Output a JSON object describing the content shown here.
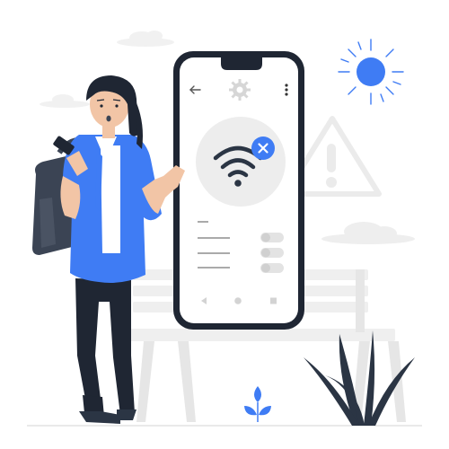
{
  "illustration": {
    "icons": {
      "back": "arrow-left-icon",
      "settings": "gear-icon",
      "menu": "more-vertical-icon",
      "wifi": "wifi-off-icon",
      "warning": "warning-triangle-icon",
      "sun": "sun-icon"
    },
    "colors": {
      "accent": "#3f7cf4",
      "dark": "#2b3544",
      "phone_frame": "#1f2633",
      "light_gray": "#ececec",
      "mid_gray": "#d9d9d9",
      "skin": "#f2c5a6"
    },
    "phone_toggles": [
      false,
      false,
      false
    ]
  }
}
